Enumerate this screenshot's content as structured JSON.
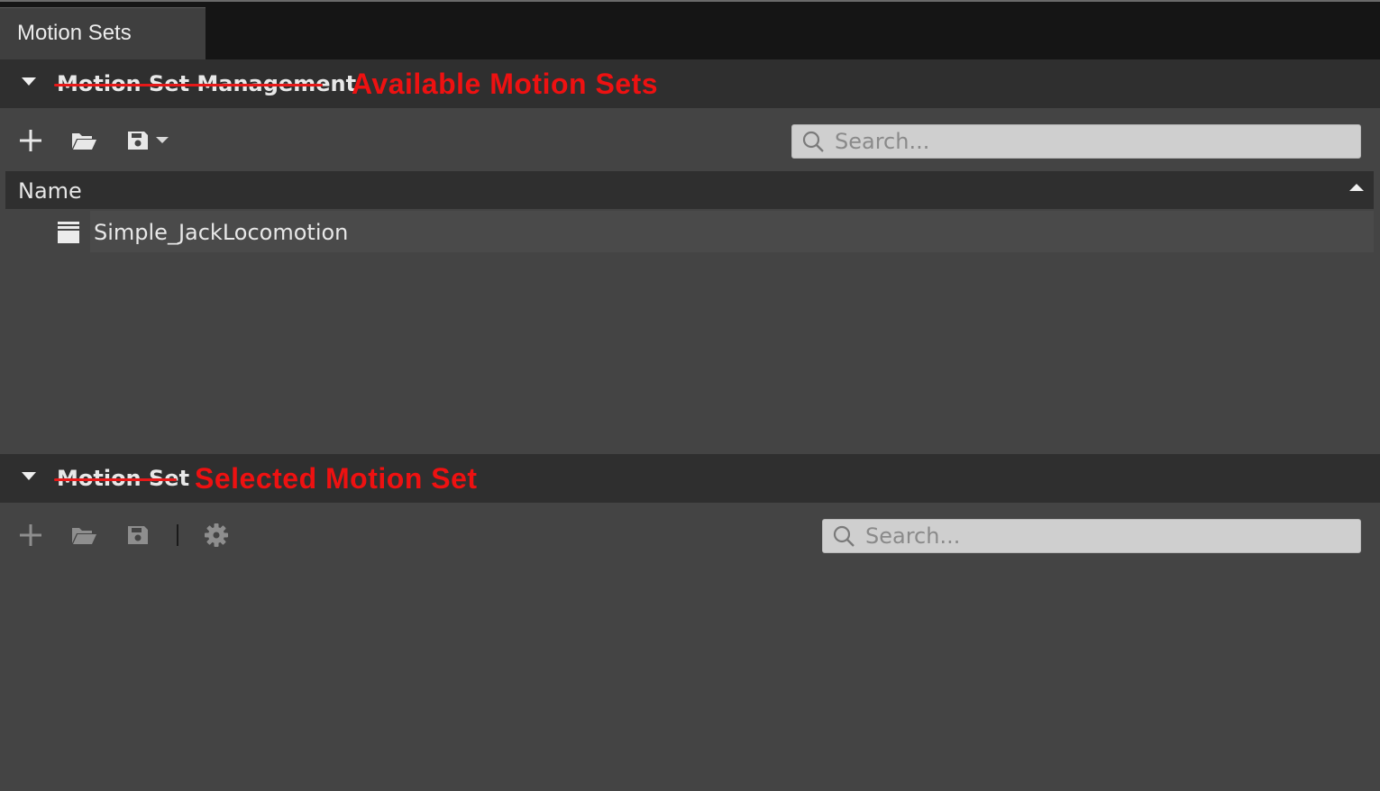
{
  "window": {
    "tab_label": "Motion Sets"
  },
  "management": {
    "title": "Motion Set Management",
    "annotation": "Available Motion Sets",
    "search_placeholder": "Search...",
    "table": {
      "columns": [
        "Name"
      ],
      "rows": [
        {
          "name": "Simple_JackLocomotion",
          "icon": "motion-set-stack-icon"
        }
      ]
    },
    "toolbar_icons": [
      "add-icon",
      "open-folder-icon",
      "save-icon",
      "dropdown-arrow-icon"
    ]
  },
  "motion_set": {
    "title": "Motion Set",
    "annotation": "Selected Motion Set",
    "search_placeholder": "Search...",
    "toolbar_icons": [
      "add-icon",
      "open-folder-icon",
      "save-icon",
      "gear-icon"
    ]
  },
  "colors": {
    "annotation_red": "#ee1111",
    "panel_bg": "#444444",
    "header_bg": "#2f2f2f",
    "tabbar_bg": "#151515"
  }
}
